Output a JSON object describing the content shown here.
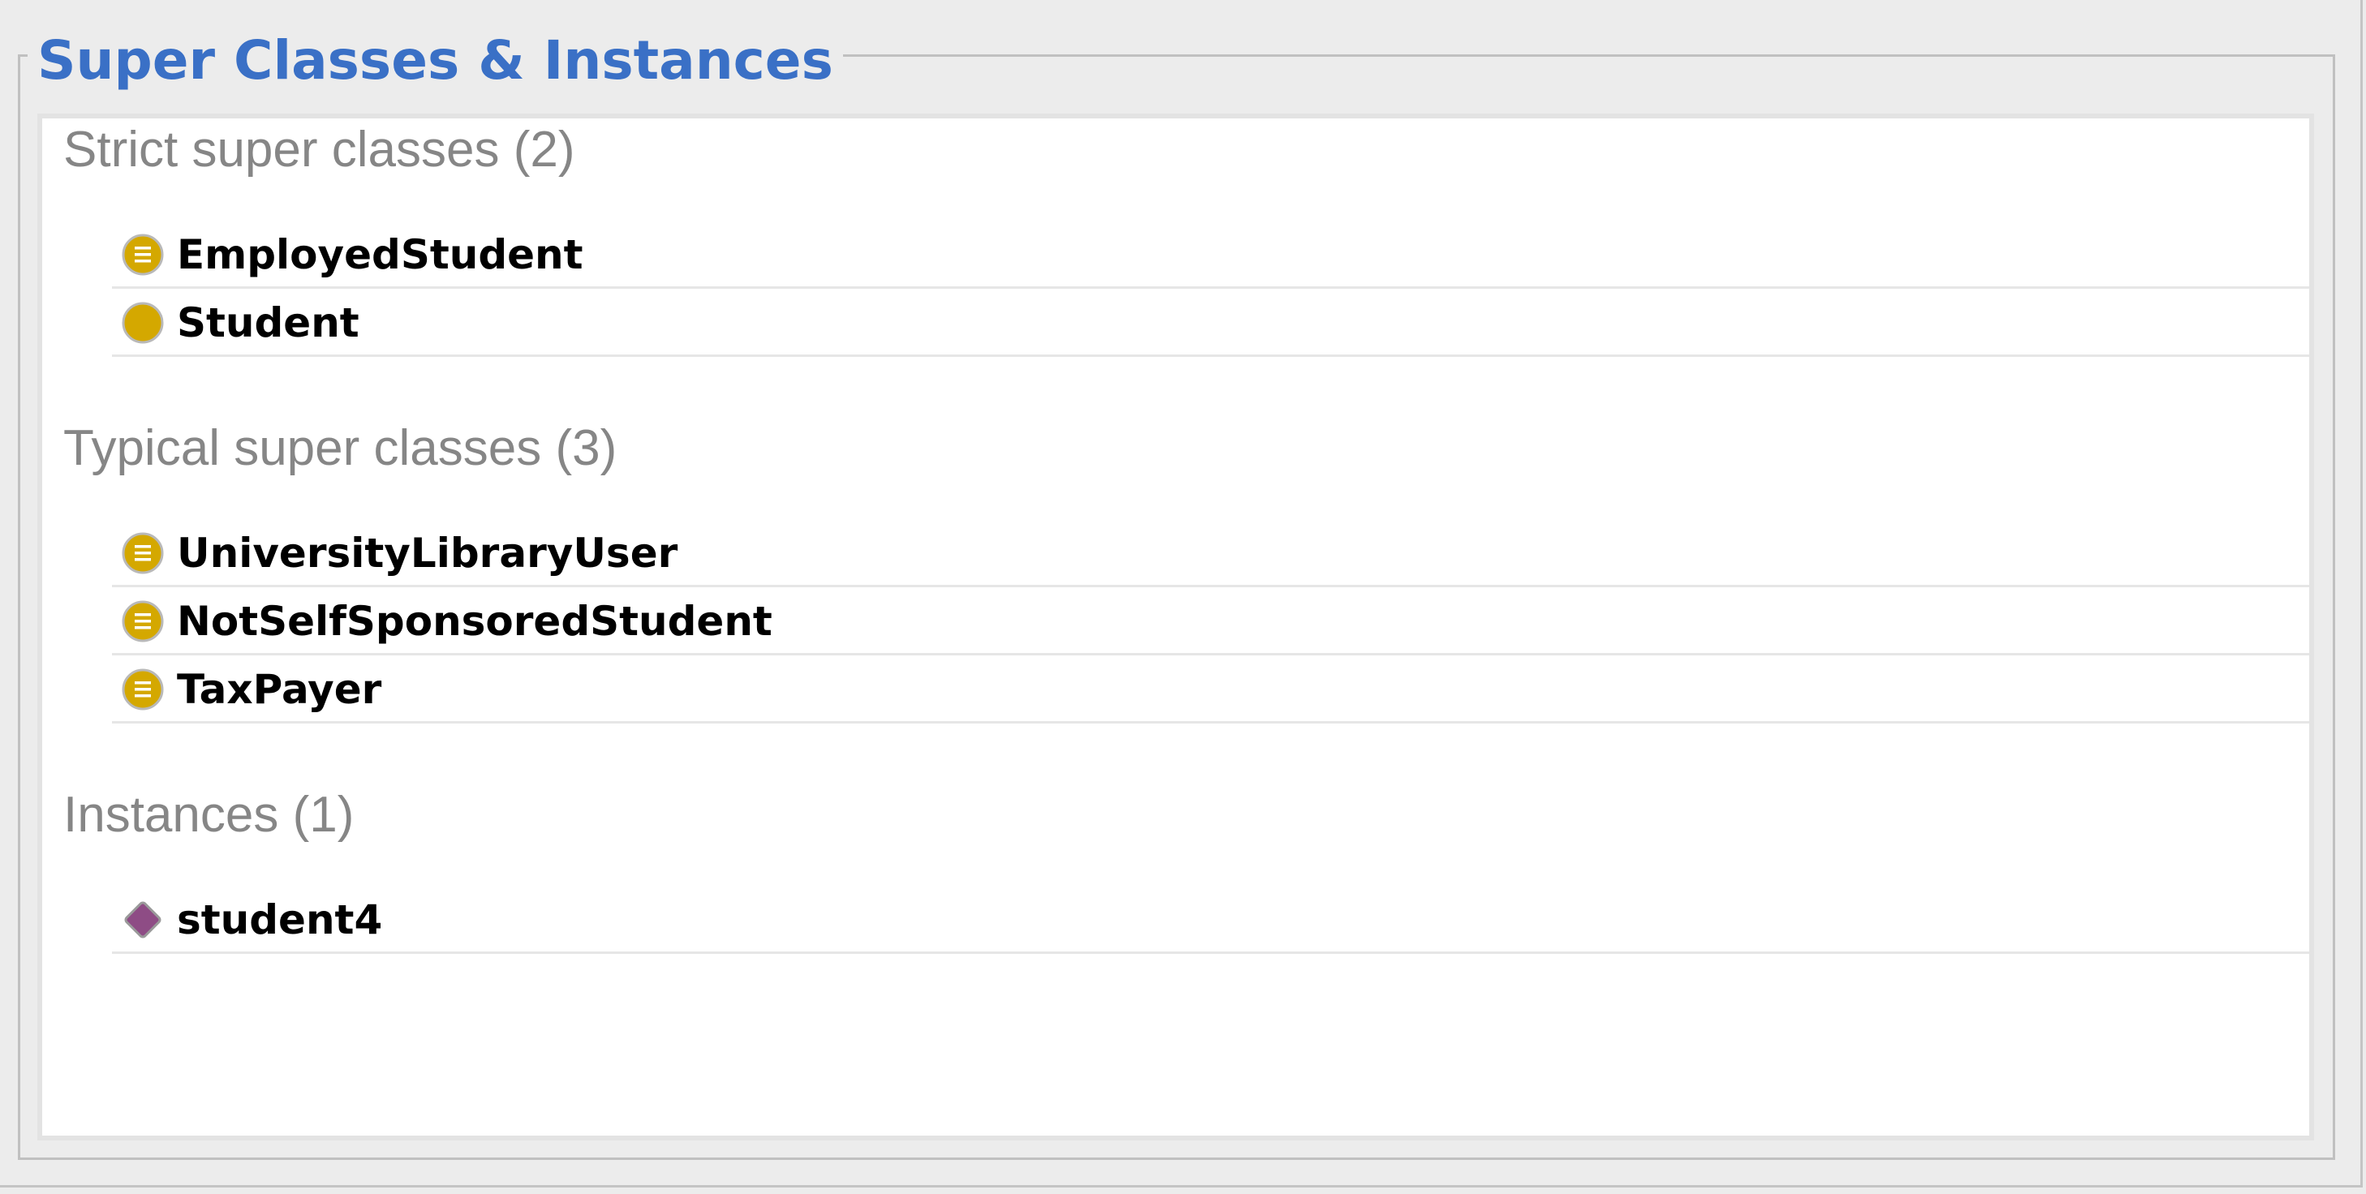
{
  "panel": {
    "title": "Super Classes & Instances"
  },
  "sections": {
    "strict": {
      "header": "Strict super classes (2)",
      "items": [
        {
          "label": "EmployedStudent",
          "icon": "defined-class-icon"
        },
        {
          "label": "Student",
          "icon": "class-icon"
        }
      ]
    },
    "typical": {
      "header": "Typical super classes (3)",
      "items": [
        {
          "label": "UniversityLibraryUser",
          "icon": "defined-class-icon"
        },
        {
          "label": "NotSelfSponsoredStudent",
          "icon": "defined-class-icon"
        },
        {
          "label": "TaxPayer",
          "icon": "defined-class-icon"
        }
      ]
    },
    "instances": {
      "header": "Instances (1)",
      "items": [
        {
          "label": "student4",
          "icon": "individual-icon"
        }
      ]
    }
  },
  "colors": {
    "title": "#3a70c6",
    "section_header": "#868686",
    "class_icon": "#d4a800",
    "individual_icon": "#8e4c85"
  }
}
